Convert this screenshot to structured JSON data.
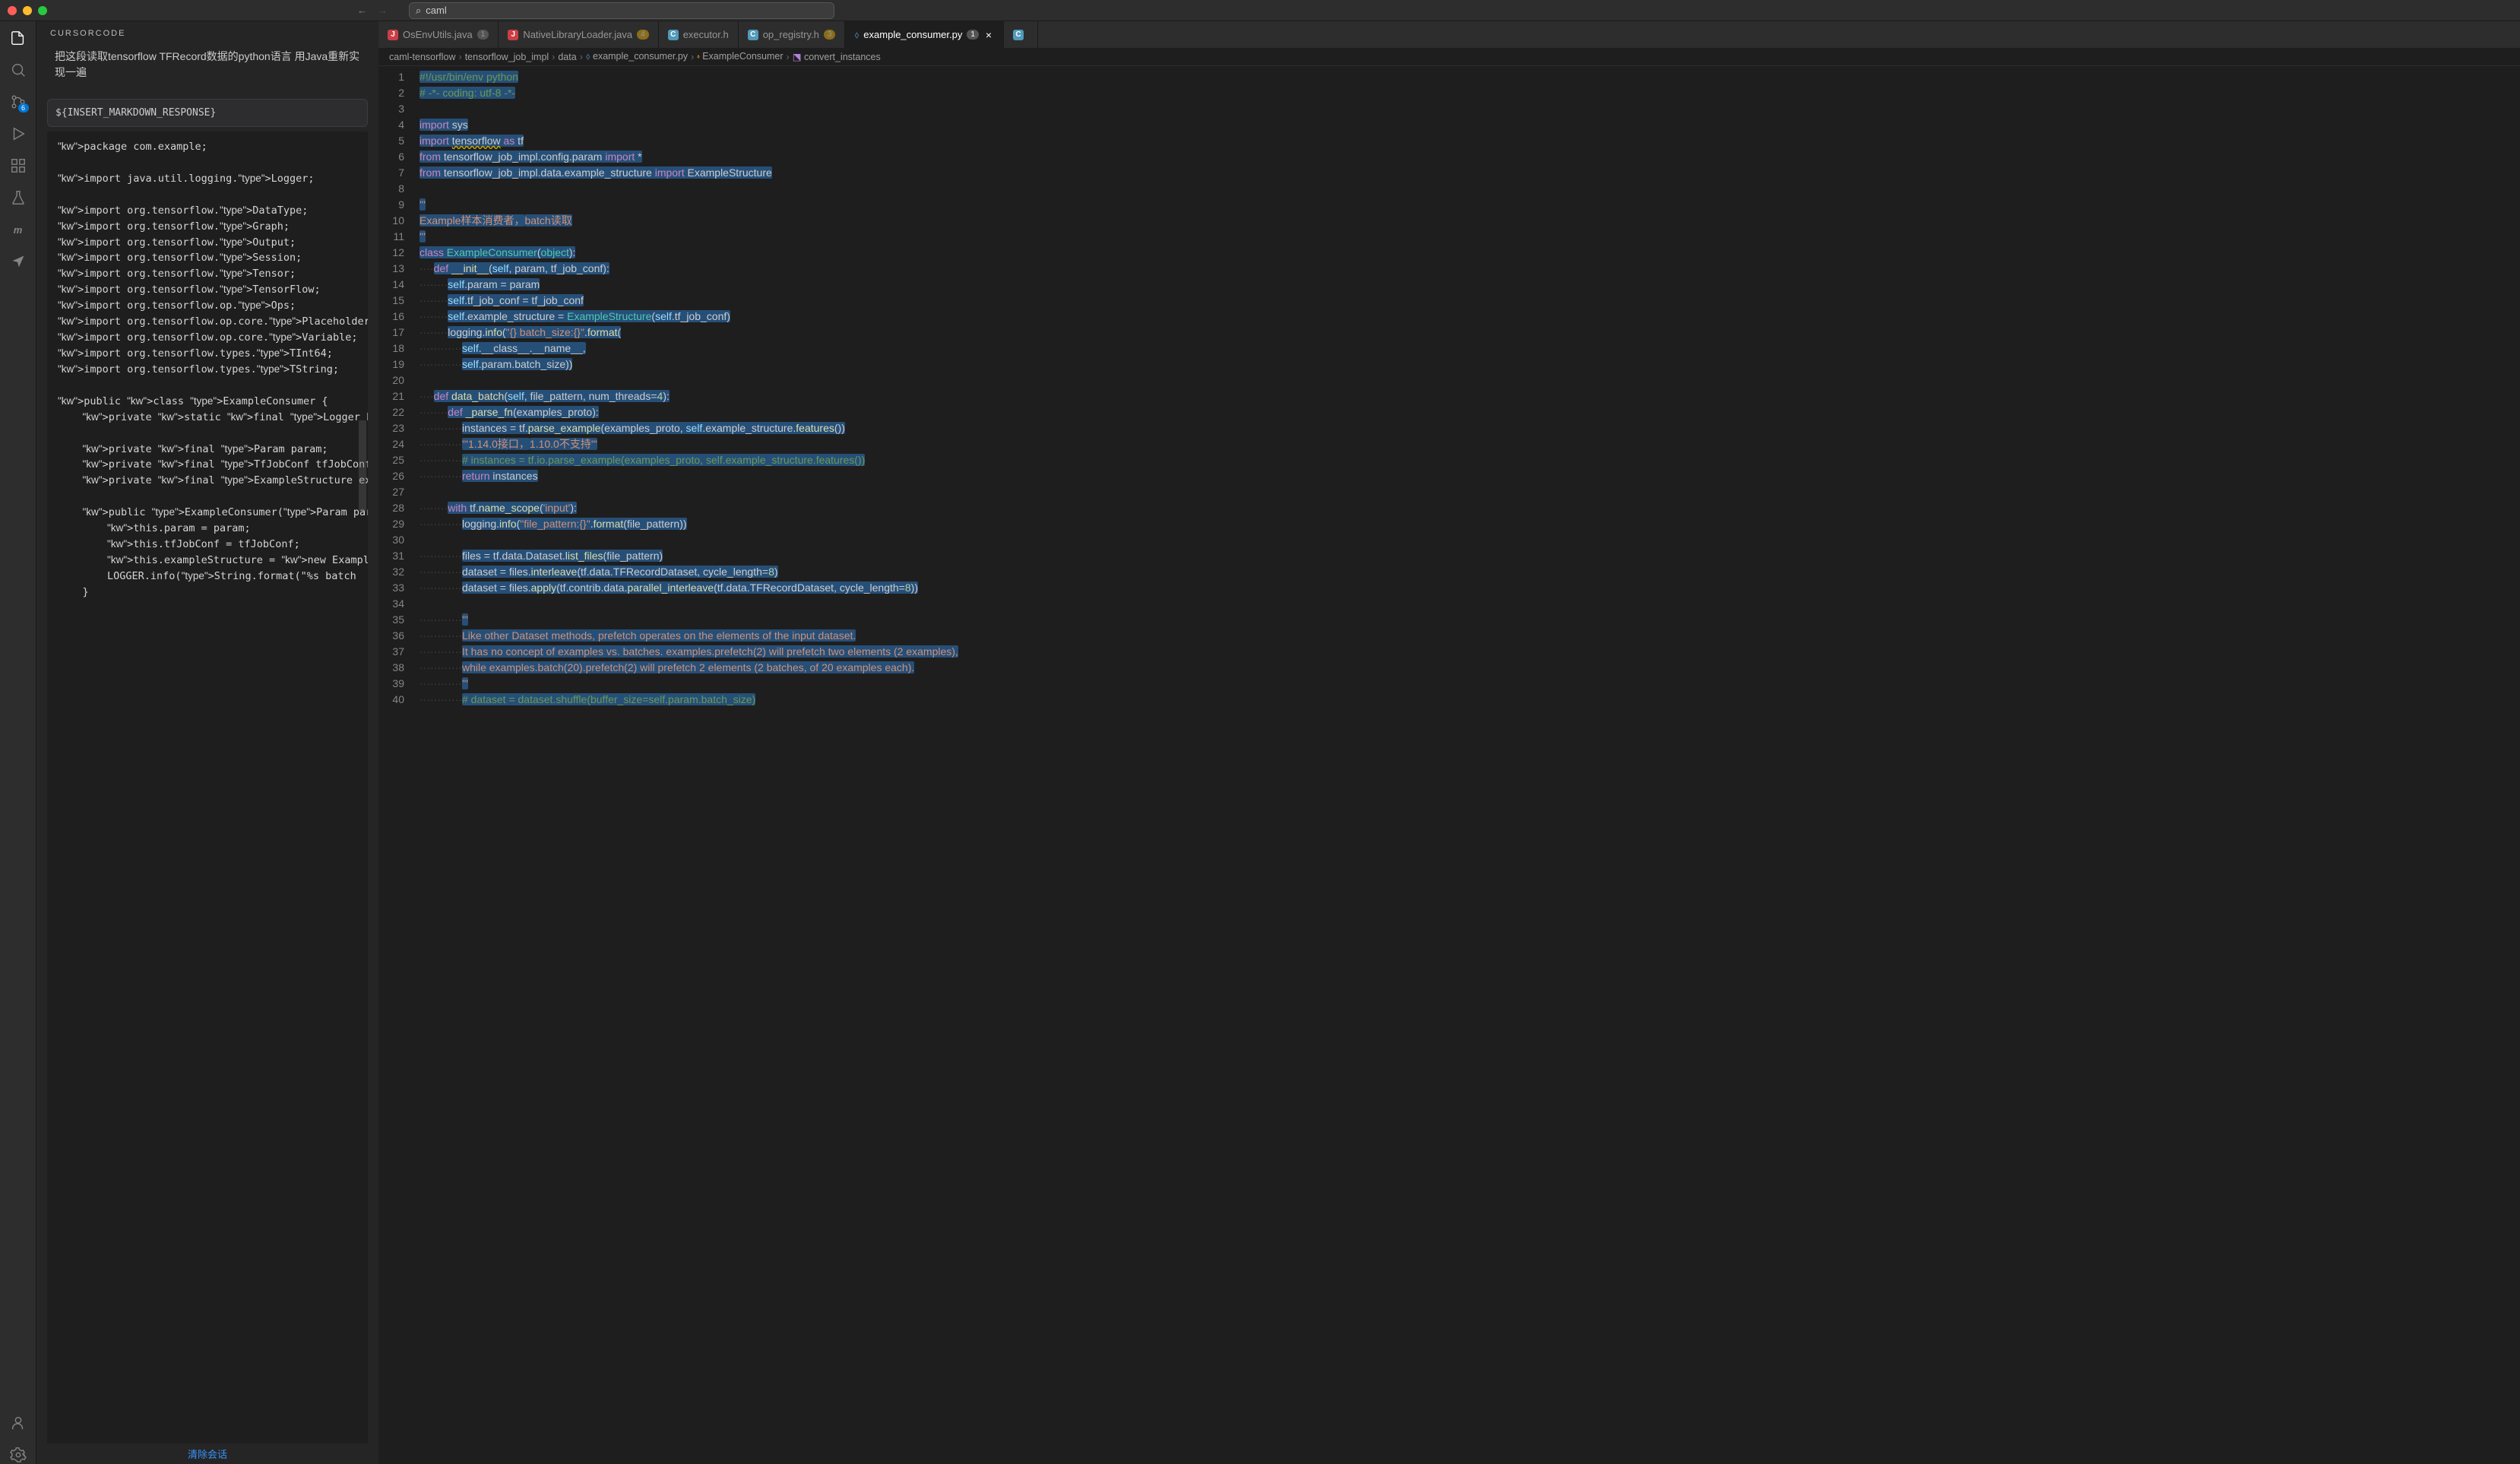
{
  "titlebar": {
    "search_value": "caml"
  },
  "activitybar": {
    "scm_badge": "6"
  },
  "sidebar": {
    "title": "CURSORCODE",
    "prompt": "把这段读取tensorflow TFRecord数据的python语言 用Java重新实现一遍",
    "response_placeholder": "${INSERT_MARKDOWN_RESPONSE}",
    "clear_link": "清除会话",
    "java_code": [
      "package com.example;",
      "",
      "import java.util.logging.Logger;",
      "",
      "import org.tensorflow.DataType;",
      "import org.tensorflow.Graph;",
      "import org.tensorflow.Output;",
      "import org.tensorflow.Session;",
      "import org.tensorflow.Tensor;",
      "import org.tensorflow.TensorFlow;",
      "import org.tensorflow.op.Ops;",
      "import org.tensorflow.op.core.Placeholder;",
      "import org.tensorflow.op.core.Variable;",
      "import org.tensorflow.types.TInt64;",
      "import org.tensorflow.types.TString;",
      "",
      "public class ExampleConsumer {",
      "    private static final Logger LOGGER = Lo",
      "",
      "    private final Param param;",
      "    private final TfJobConf tfJobConf;",
      "    private final ExampleStructure exampleS",
      "",
      "    public ExampleConsumer(Param param, TfJ",
      "        this.param = param;",
      "        this.tfJobConf = tfJobConf;",
      "        this.exampleStructure = new Example",
      "        LOGGER.info(String.format(\"%s batch",
      "    }"
    ]
  },
  "tabs": [
    {
      "icon": "java",
      "label": "OsEnvUtils.java",
      "badge": "1"
    },
    {
      "icon": "java",
      "label": "NativeLibraryLoader.java",
      "badge": "4"
    },
    {
      "icon": "c",
      "label": "executor.h",
      "badge": ""
    },
    {
      "icon": "c",
      "label": "op_registry.h",
      "badge": "3"
    },
    {
      "icon": "py",
      "label": "example_consumer.py",
      "badge": "1",
      "active": true,
      "closable": true
    },
    {
      "icon": "c",
      "label": "",
      "badge": "",
      "overflow": true
    }
  ],
  "breadcrumb": [
    "caml-tensorflow",
    "tensorflow_job_impl",
    "data",
    "example_consumer.py",
    "ExampleConsumer",
    "convert_instances"
  ],
  "editor": {
    "lines": [
      {
        "n": 1,
        "html": "<span class='sel'><span class='cmt'>#!/usr/bin/env python</span></span>"
      },
      {
        "n": 2,
        "html": "<span class='sel'><span class='cmt'># -*- coding: utf-8 -*-</span></span>"
      },
      {
        "n": 3,
        "html": ""
      },
      {
        "n": 4,
        "html": "<span class='sel'><span class='kw2'>import</span> sys</span>"
      },
      {
        "n": 5,
        "html": "<span class='sel'><span class='kw2'>import</span> <span style='text-decoration:underline wavy #cca700'>tensorflow</span> <span class='kw2'>as</span> tf</span>"
      },
      {
        "n": 6,
        "html": "<span class='sel'><span class='kw2'>from</span> tensorflow_job_impl.config.param <span class='kw2'>import</span> *</span>"
      },
      {
        "n": 7,
        "html": "<span class='sel'><span class='kw2'>from</span> tensorflow_job_impl.data.example_structure <span class='kw2'>import</span> ExampleStructure</span>"
      },
      {
        "n": 8,
        "html": ""
      },
      {
        "n": 9,
        "html": "<span class='sel'><span class='str2'>'''</span></span>"
      },
      {
        "n": 10,
        "html": "<span class='sel'><span class='str2'>Example样本消费者，</span></span><span class='sel'><span class='str2'>batch读取</span></span>"
      },
      {
        "n": 11,
        "html": "<span class='sel'><span class='str2'>'''</span></span>"
      },
      {
        "n": 12,
        "html": "<span class='sel'><span class='kw2'>class</span> <span class='cls'>ExampleConsumer</span>(<span class='cls'>object</span>):</span>"
      },
      {
        "n": 13,
        "html": "<span class='dots'>····</span><span class='sel'><span class='kw2'>def</span> <span class='fn'>__init__</span>(<span class='self'>self</span>, param, tf_job_conf):</span>"
      },
      {
        "n": 14,
        "html": "<span class='dots'>········</span><span class='sel'><span class='self'>self</span>.param = param</span>"
      },
      {
        "n": 15,
        "html": "<span class='dots'>········</span><span class='sel'><span class='self'>self</span>.tf_job_conf = tf_job_conf</span>"
      },
      {
        "n": 16,
        "html": "<span class='dots'>········</span><span class='sel'><span class='self'>self</span>.example_structure = <span class='cls'>ExampleStructure</span>(<span class='self'>self</span>.tf_job_conf)</span>"
      },
      {
        "n": 17,
        "html": "<span class='dots'>········</span><span class='sel'>logging.<span class='fn'>info</span>(<span class='str2'>\"{} batch_size:{}\"</span>.<span class='fn'>format</span>(</span>"
      },
      {
        "n": 18,
        "html": "<span class='dots'>············</span><span class='sel'><span class='self'>self</span>.__class__.__name__,</span>"
      },
      {
        "n": 19,
        "html": "<span class='dots'>············</span><span class='sel'><span class='self'>self</span>.param.batch_size))</span>"
      },
      {
        "n": 20,
        "html": ""
      },
      {
        "n": 21,
        "html": "<span class='dots'>····</span><span class='sel'><span class='kw2'>def</span> <span class='fn'>data_batch</span>(<span class='self'>self</span>, file_pattern, num_threads=<span class='num'>4</span>):</span>"
      },
      {
        "n": 22,
        "html": "<span class='dots'>········</span><span class='sel'><span class='kw2'>def</span> <span class='fn'>_parse_fn</span>(examples_proto):</span>"
      },
      {
        "n": 23,
        "html": "<span class='dots'>············</span><span class='sel'>instances = tf.<span class='fn'>parse_example</span>(examples_proto, <span class='self'>self</span>.example_structure.<span class='fn'>features</span>())</span>"
      },
      {
        "n": 24,
        "html": "<span class='dots'>············</span><span class='sel'><span class='str2'>'''1.14.0接口，</span></span><span class='sel'><span class='str2'>1.10.0不支持'''</span></span>"
      },
      {
        "n": 25,
        "html": "<span class='dots'>············</span><span class='sel'><span class='cmt'># instances = tf.io.parse_example(examples_proto, self.example_structure.features())</span></span>"
      },
      {
        "n": 26,
        "html": "<span class='dots'>············</span><span class='sel'><span class='kw2'>return</span> instances</span>"
      },
      {
        "n": 27,
        "html": ""
      },
      {
        "n": 28,
        "html": "<span class='dots'>········</span><span class='sel'><span class='kw2'>with</span> tf.<span class='fn'>name_scope</span>(<span class='str2'>'input'</span>):</span>"
      },
      {
        "n": 29,
        "html": "<span class='dots'>············</span><span class='sel'>logging.<span class='fn'>info</span>(<span class='str2'>\"file_pattern:{}\"</span>.<span class='fn'>format</span>(file_pattern))</span>"
      },
      {
        "n": 30,
        "html": ""
      },
      {
        "n": 31,
        "html": "<span class='dots'>············</span><span class='sel'>files = tf.data.Dataset.<span class='fn'>list_files</span>(file_pattern)</span>"
      },
      {
        "n": 32,
        "html": "<span class='dots'>············</span><span class='sel'>dataset = files.<span class='fn'>interleave</span>(tf.data.TFRecordDataset, cycle_length=<span class='num'>8</span>)</span>"
      },
      {
        "n": 33,
        "html": "<span class='dots'>············</span><span class='sel'>dataset = files.<span class='fn'>apply</span>(tf.contrib.data.<span class='fn'>parallel_interleave</span>(tf.data.TFRecordDataset, cycle_length=<span class='num'>8</span>))</span>"
      },
      {
        "n": 34,
        "html": ""
      },
      {
        "n": 35,
        "html": "<span class='dots'>············</span><span class='sel'><span class='str2'>'''</span></span>"
      },
      {
        "n": 36,
        "html": "<span class='dots'>············</span><span class='sel'><span class='str2'>Like other Dataset methods, prefetch operates on the elements of the input dataset.</span></span>"
      },
      {
        "n": 37,
        "html": "<span class='dots'>············</span><span class='sel'><span class='str2'>It has no concept of examples vs. batches. examples.prefetch(2) will prefetch two elements (2 examples),</span></span>"
      },
      {
        "n": 38,
        "html": "<span class='dots'>············</span><span class='sel'><span class='str2'>while examples.batch(20).prefetch(2) will prefetch 2 elements (2 batches, of 20 examples each).</span></span>"
      },
      {
        "n": 39,
        "html": "<span class='dots'>············</span><span class='sel'><span class='str2'>'''</span></span>"
      },
      {
        "n": 40,
        "html": "<span class='dots'>············</span><span class='sel'><span class='cmt'># dataset = dataset.shuffle(buffer_size=self.param.batch_size)</span></span>"
      }
    ]
  }
}
